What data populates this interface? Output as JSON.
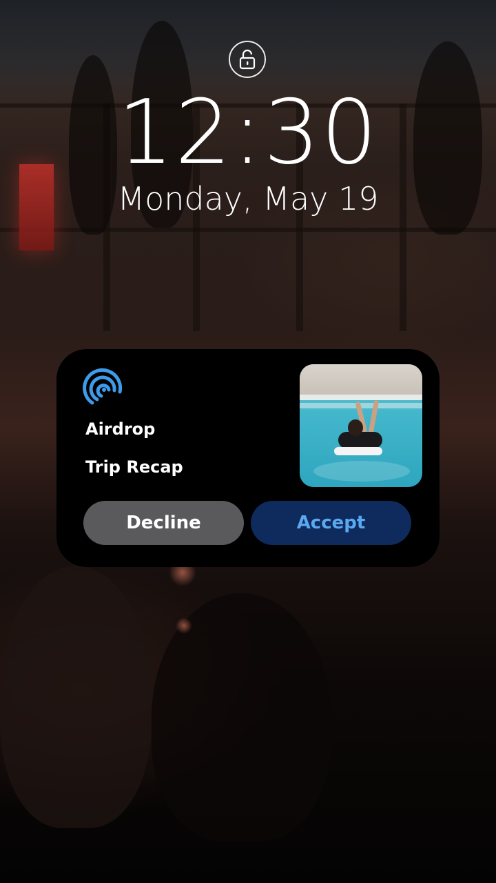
{
  "lock_screen": {
    "lock_icon": "unlocked-padlock-icon",
    "time": "12:30",
    "date": "Monday, May 19"
  },
  "airdrop_card": {
    "icon": "airdrop-icon",
    "app_name": "Airdrop",
    "item_name": "Trip Recap",
    "thumbnail": "pool-photo-thumbnail",
    "decline_label": "Decline",
    "accept_label": "Accept"
  },
  "colors": {
    "card_background": "#000000",
    "decline_button": "#5a5a5c",
    "accept_button": "#0f2a5c",
    "accept_text": "#5aa9f0",
    "airdrop_icon": "#3d9be9"
  }
}
